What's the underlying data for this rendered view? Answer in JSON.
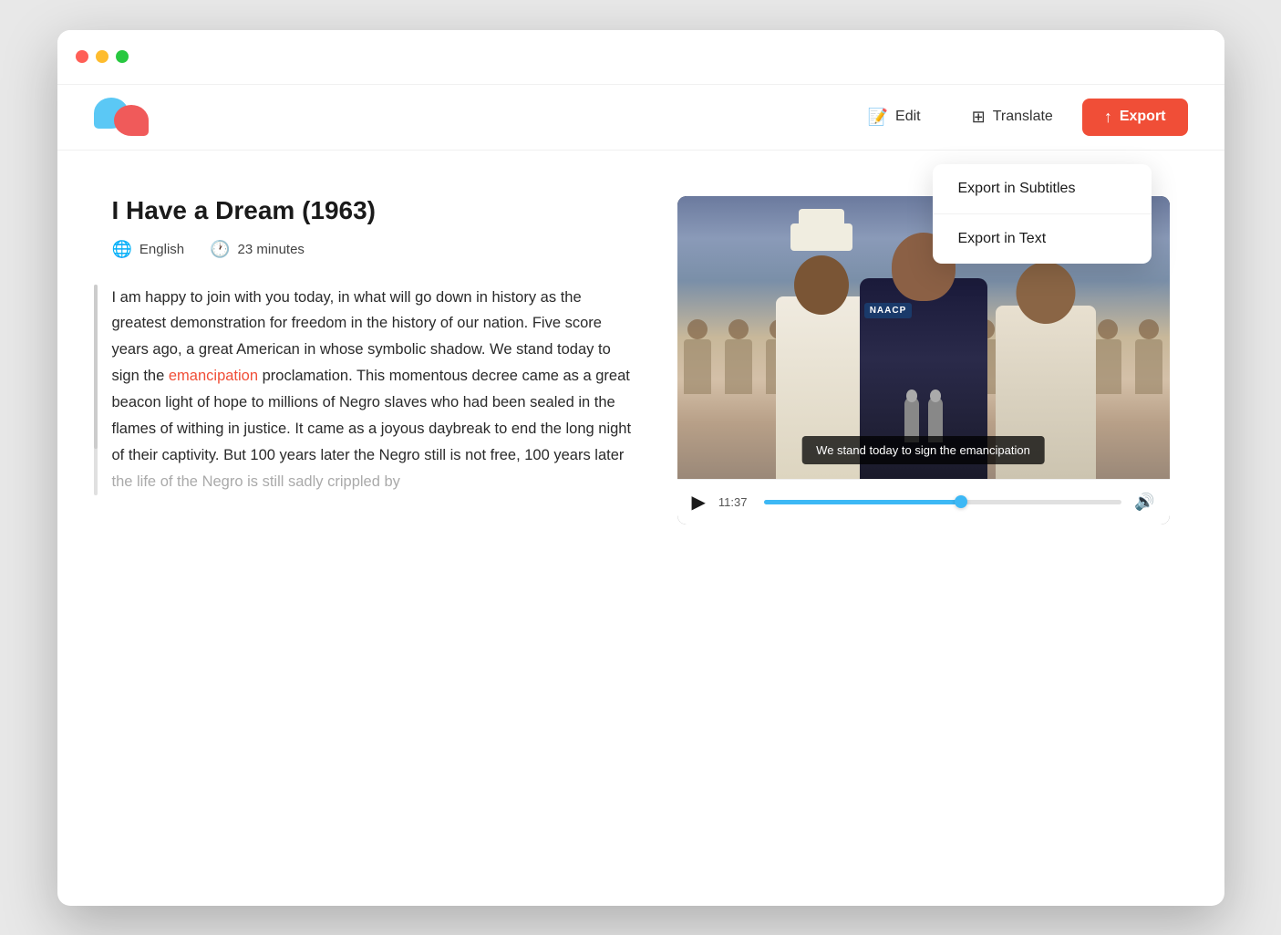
{
  "window": {
    "traffic_lights": [
      "red",
      "yellow",
      "green"
    ]
  },
  "header": {
    "logo_alt": "App Logo",
    "nav": {
      "edit_label": "Edit",
      "translate_label": "Translate",
      "export_label": "Export",
      "edit_icon": "✎",
      "translate_icon": "⊞",
      "export_icon": "↑"
    },
    "dropdown": {
      "export_subtitles_label": "Export in Subtitles",
      "export_text_label": "Export in Text"
    }
  },
  "document": {
    "title": "I Have a Dream (1963)",
    "language": "English",
    "duration": "23 minutes",
    "text_part1": "I am happy to join with you today, in what will go down in history as the greatest demonstration for freedom in the history of our nation. Five score years ago, a great American in whose symbolic shadow. We stand today to sign the ",
    "highlight_word": "emancipation",
    "text_part2": " proclamation. This momentous decree came as a great beacon light of hope to millions of Negro slaves who had been sealed in the flames of withing in justice. It came as a joyous daybreak to end the long night of their captivity. But 100 years later the Negro still is not free, 100 years later the life of the Negro is still sadly crippled by",
    "text_fade": "the life of the Negro is still sadly crippled by"
  },
  "video": {
    "subtitle_text": "We stand today to sign the emancipation",
    "naacp_text": "NAACP",
    "current_time": "11:37",
    "progress_percent": 55
  }
}
